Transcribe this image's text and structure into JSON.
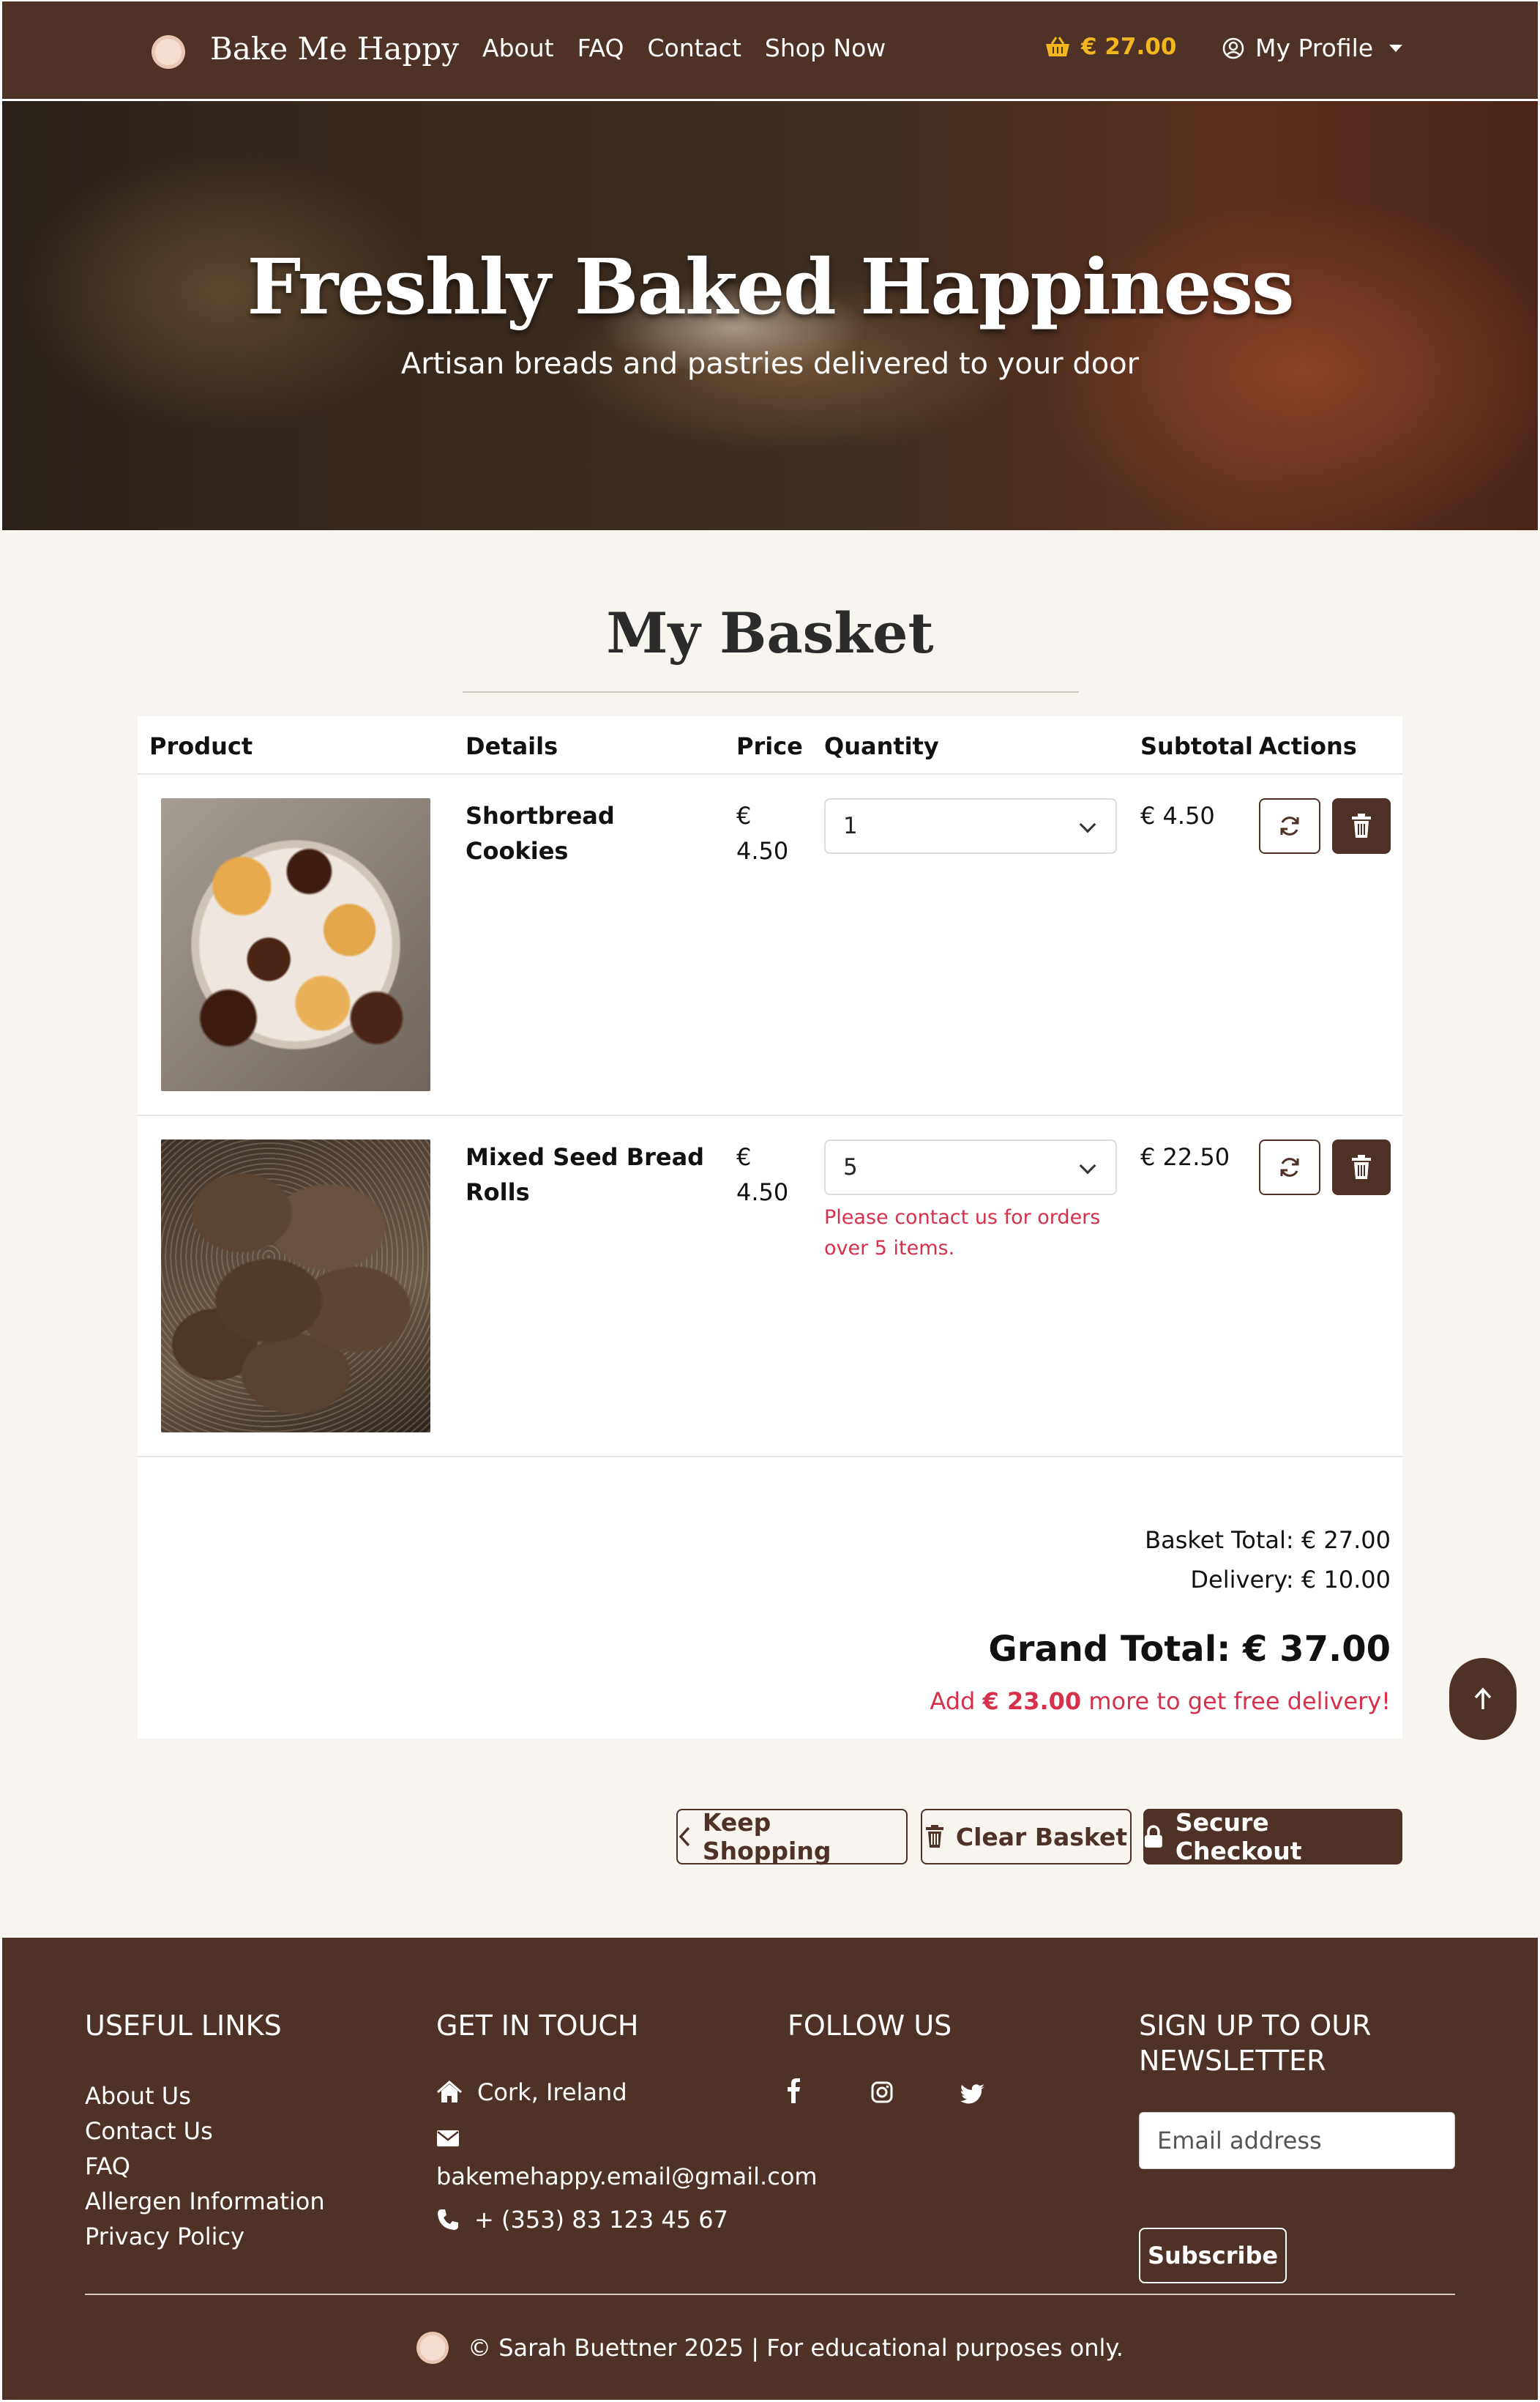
{
  "nav": {
    "brand": "Bake Me Happy",
    "links": [
      "About",
      "FAQ",
      "Contact",
      "Shop Now"
    ],
    "cart_total": "€ 27.00",
    "profile_label": "My Profile"
  },
  "hero": {
    "title": "Freshly Baked Happiness",
    "subtitle": "Artisan breads and pastries delivered to your door"
  },
  "basket": {
    "title": "My Basket",
    "headers": {
      "product": "Product",
      "details": "Details",
      "price": "Price",
      "quantity": "Quantity",
      "subtotal": "Subtotal",
      "actions": "Actions"
    },
    "items": [
      {
        "name": "Shortbread Cookies",
        "price_symbol": "€",
        "price_value": "4.50",
        "quantity": "1",
        "subtotal": "€ 4.50",
        "error": ""
      },
      {
        "name": "Mixed Seed Bread Rolls",
        "price_symbol": "€",
        "price_value": "4.50",
        "quantity": "5",
        "subtotal": "€ 22.50",
        "error": "Please contact us for orders over 5 items."
      }
    ],
    "basket_total": "Basket Total: € 27.00",
    "delivery": "Delivery: € 10.00",
    "grand_total": "Grand Total: € 37.00",
    "free_prefix": "Add ",
    "free_amount": "€ 23.00",
    "free_suffix": " more to get free delivery!"
  },
  "actions": {
    "keep_shopping": "Keep Shopping",
    "clear_basket": "Clear Basket",
    "secure_checkout": "Secure Checkout"
  },
  "footer": {
    "useful_links_heading": "USEFUL LINKS",
    "useful_links": [
      "About Us",
      "Contact Us",
      "FAQ",
      "Allergen Information",
      "Privacy Policy"
    ],
    "get_in_touch_heading": "GET IN TOUCH",
    "address": "Cork, Ireland",
    "email": "bakemehappy.email@gmail.com",
    "phone": "+ (353) 83 123 45 67",
    "follow_heading": "FOLLOW US",
    "newsletter_heading_1": "SIGN UP TO OUR",
    "newsletter_heading_2": "NEWSLETTER",
    "email_placeholder": "Email address",
    "subscribe_label": "Subscribe",
    "copyright": "© Sarah Buettner 2025 | For educational purposes only."
  },
  "colors": {
    "brand_brown": "#4e3227",
    "cart_gold": "#f2b61e",
    "error_red": "#d6304a",
    "page_bg": "#f8f4ef"
  },
  "icons": [
    "basket-icon",
    "user-circle-icon",
    "refresh-icon",
    "trash-icon",
    "chevron-left-icon",
    "lock-icon",
    "home-icon",
    "envelope-icon",
    "phone-icon",
    "facebook-icon",
    "instagram-icon",
    "twitter-icon",
    "arrow-up-icon"
  ]
}
